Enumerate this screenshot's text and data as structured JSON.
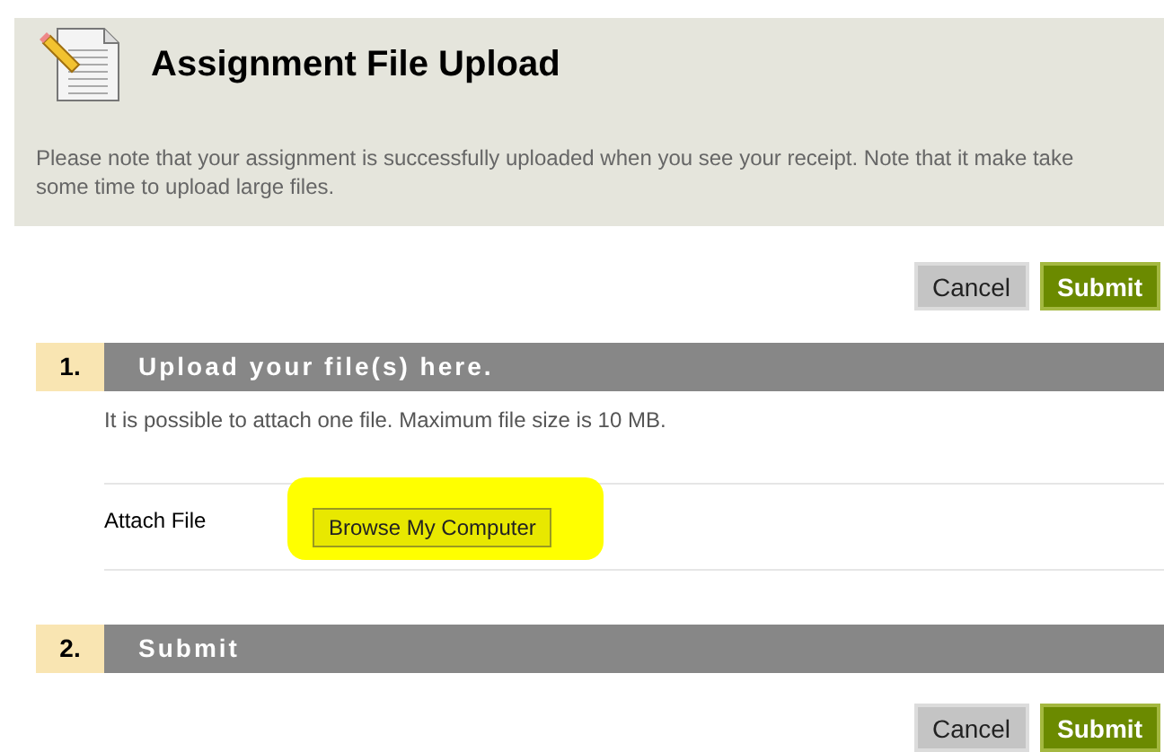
{
  "header": {
    "title": "Assignment File Upload",
    "note": "Please note that your assignment is successfully uploaded when you see your receipt. Note that it make take some time to upload large files."
  },
  "top_buttons": [
    {
      "label": "Cancel",
      "kind": "secondary"
    },
    {
      "label": "Submit",
      "kind": "primary"
    }
  ],
  "sections": [
    {
      "number": "1.",
      "title": "Upload your file(s) here.",
      "description": "It is possible to attach one file. Maximum file size is 10 MB.",
      "field_label": "Attach File",
      "browse_button": {
        "label": "Browse My Computer",
        "highlighted": true
      }
    },
    {
      "number": "2.",
      "title": "Submit"
    }
  ],
  "bottom_buttons": [
    {
      "label": "Cancel",
      "kind": "secondary"
    },
    {
      "label": "Submit",
      "kind": "primary"
    }
  ]
}
